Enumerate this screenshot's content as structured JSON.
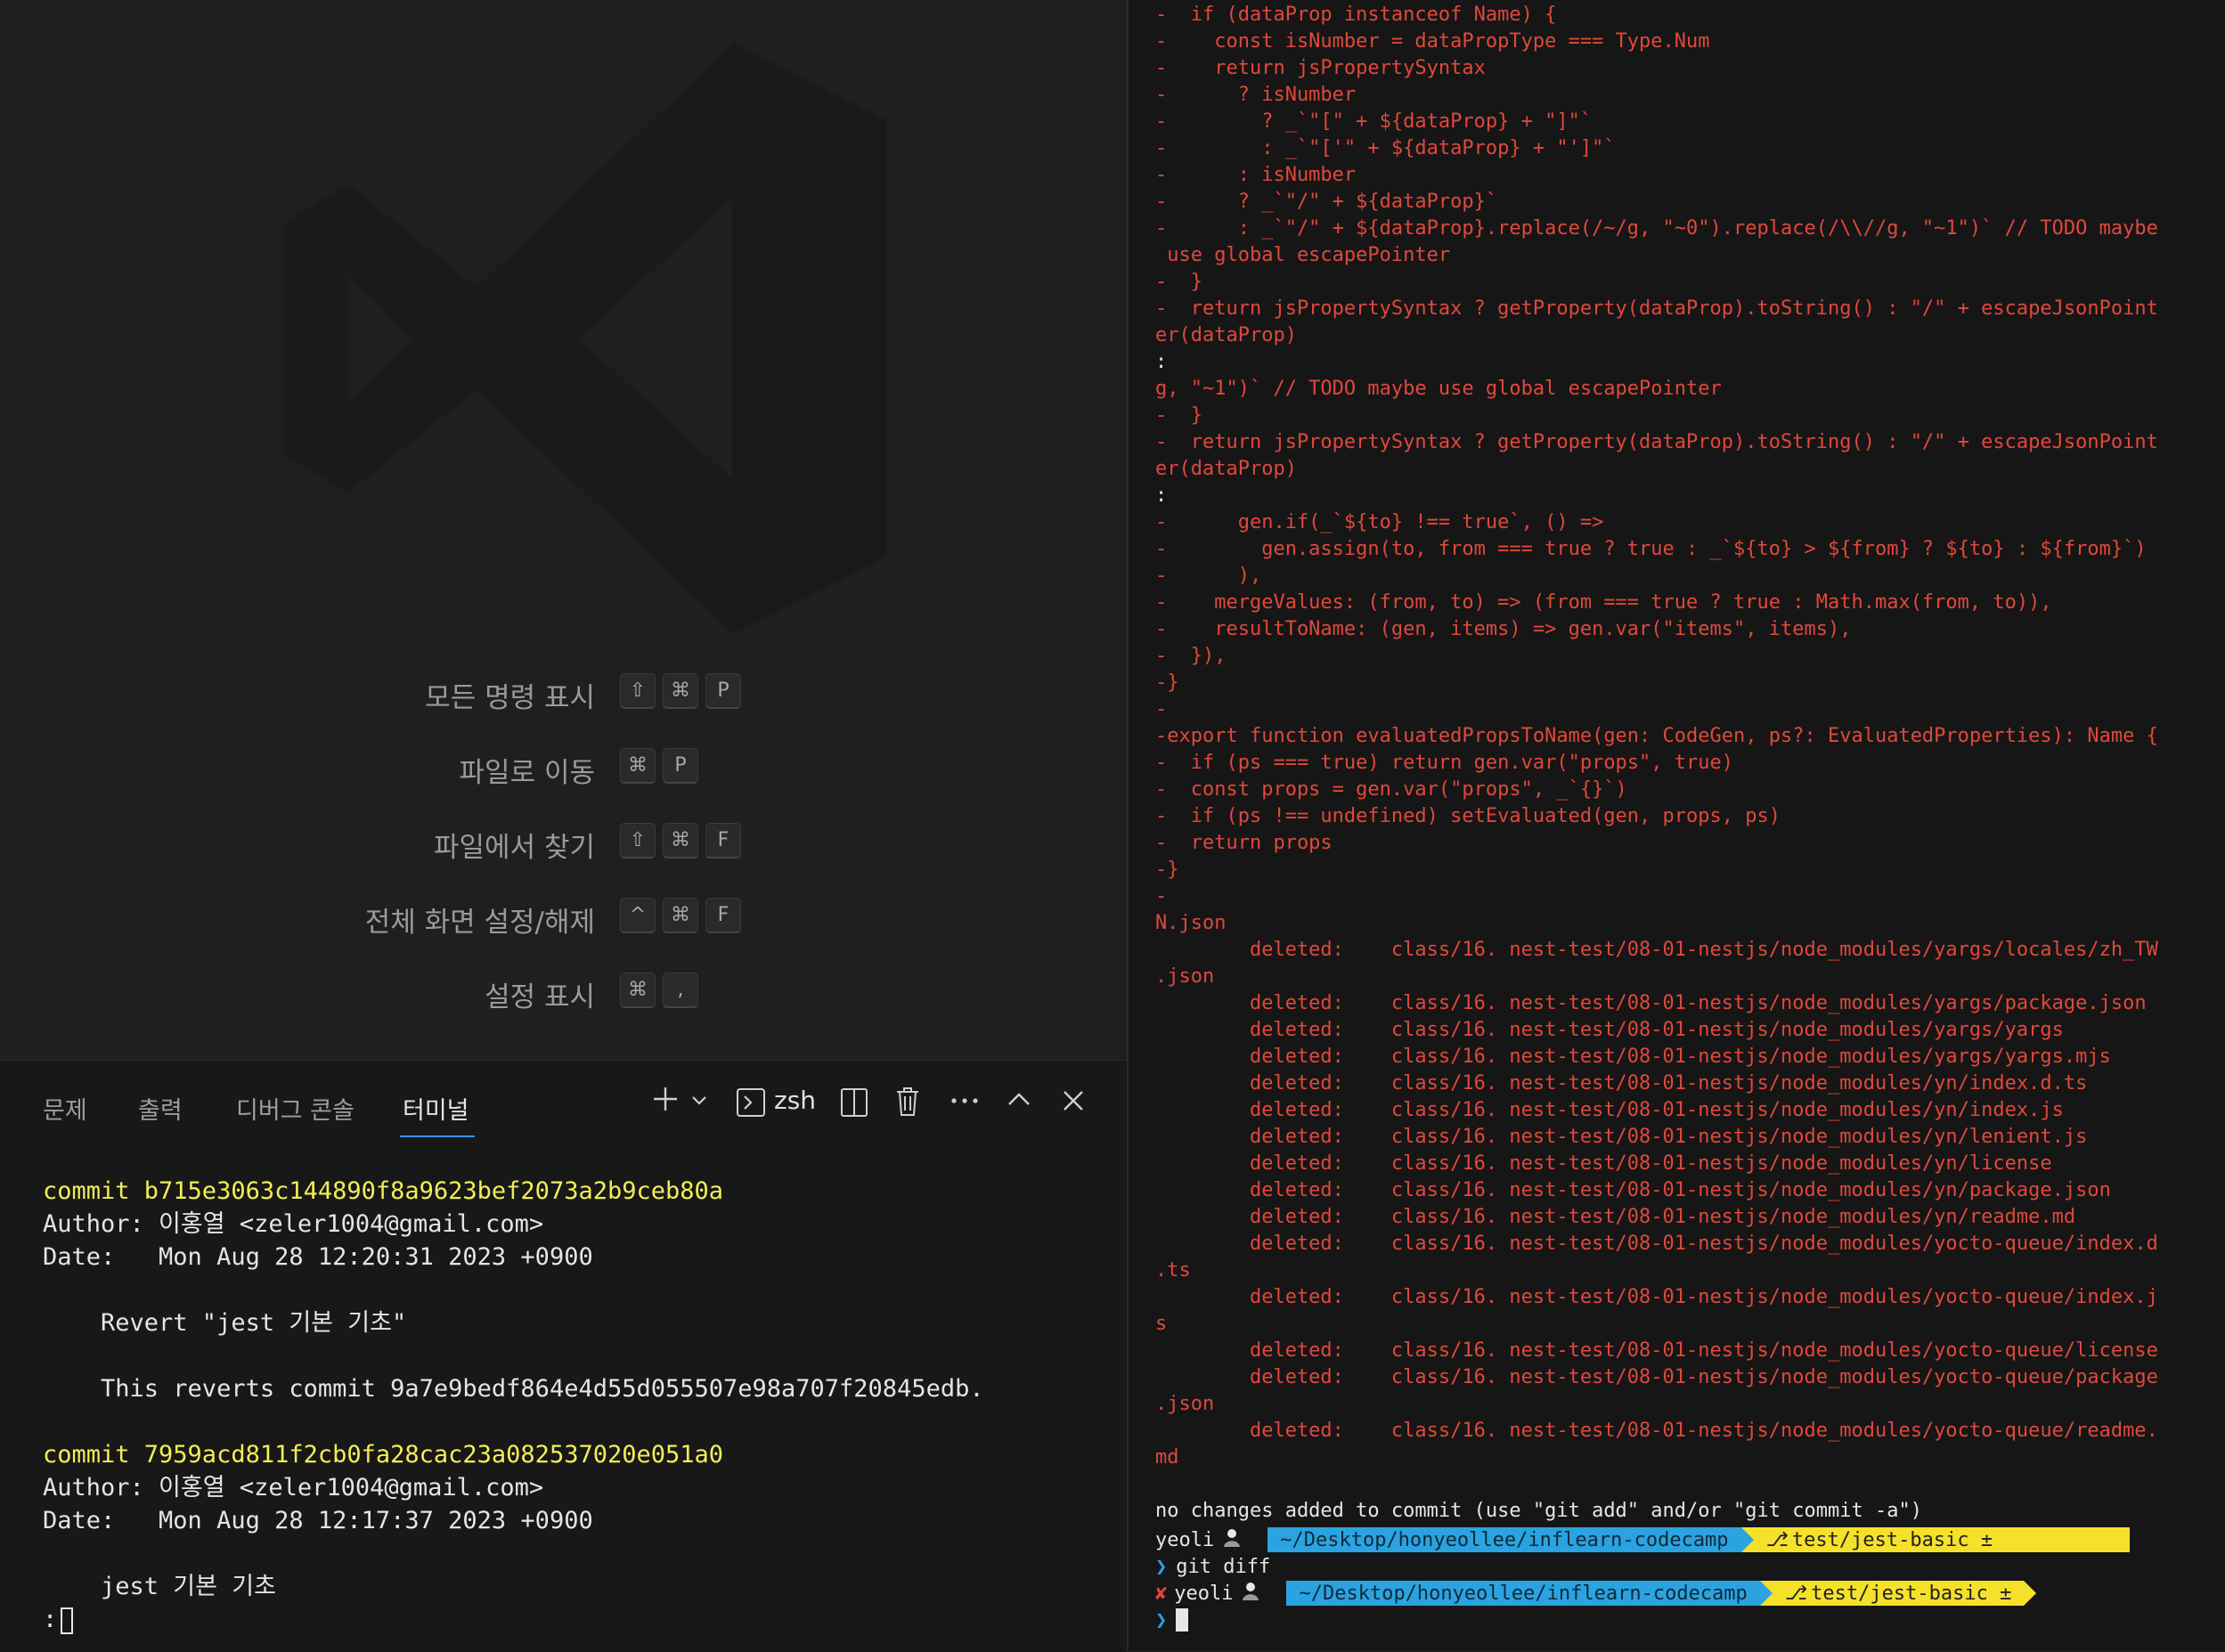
{
  "shortcuts": [
    {
      "label": "모든 명령 표시",
      "keys": [
        "⇧",
        "⌘",
        "P"
      ]
    },
    {
      "label": "파일로 이동",
      "keys": [
        "⌘",
        "P"
      ]
    },
    {
      "label": "파일에서 찾기",
      "keys": [
        "⇧",
        "⌘",
        "F"
      ]
    },
    {
      "label": "전체 화면 설정/해제",
      "keys": [
        "^",
        "⌘",
        "F"
      ]
    },
    {
      "label": "설정 표시",
      "keys": [
        "⌘",
        ","
      ]
    }
  ],
  "panel": {
    "tabs": [
      "문제",
      "출력",
      "디버그 콘솔",
      "터미널"
    ],
    "active_tab": "터미널",
    "shell_label": "zsh"
  },
  "left_terminal": {
    "lines": [
      {
        "text": "commit b715e3063c144890f8a9623bef2073a2b9ceb80a",
        "color": "yellow"
      },
      {
        "text": "Author: 이홍열 <zeler1004@gmail.com>",
        "color": "white"
      },
      {
        "text": "Date:   Mon Aug 28 12:20:31 2023 +0900",
        "color": "white"
      },
      {
        "text": "",
        "color": "white"
      },
      {
        "text": "    Revert \"jest 기본 기초\"",
        "color": "white"
      },
      {
        "text": "",
        "color": "white"
      },
      {
        "text": "    This reverts commit 9a7e9bedf864e4d55d055507e98a707f20845edb.",
        "color": "white"
      },
      {
        "text": "",
        "color": "white"
      },
      {
        "text": "commit 7959acd811f2cb0fa28cac23a082537020e051a0",
        "color": "yellow"
      },
      {
        "text": "Author: 이홍열 <zeler1004@gmail.com>",
        "color": "white"
      },
      {
        "text": "Date:   Mon Aug 28 12:17:37 2023 +0900",
        "color": "white"
      },
      {
        "text": "",
        "color": "white"
      },
      {
        "text": "    jest 기본 기초",
        "color": "white"
      },
      {
        "text": ":",
        "color": "white"
      }
    ]
  },
  "right_terminal": {
    "lines": [
      {
        "text": "-  if (dataProp instanceof Name) {",
        "color": "red"
      },
      {
        "text": "-    const isNumber = dataPropType === Type.Num",
        "color": "red"
      },
      {
        "text": "-    return jsPropertySyntax",
        "color": "red"
      },
      {
        "text": "-      ? isNumber",
        "color": "red"
      },
      {
        "text": "-        ? _`\"[\" + ${dataProp} + \"]\"`",
        "color": "red"
      },
      {
        "text": "-        : _`\"['\" + ${dataProp} + \"']\"`",
        "color": "red"
      },
      {
        "text": "-      : isNumber",
        "color": "red"
      },
      {
        "text": "-      ? _`\"/\" + ${dataProp}`",
        "color": "red"
      },
      {
        "text": "-      : _`\"/\" + ${dataProp}.replace(/~/g, \"~0\").replace(/\\\\//g, \"~1\")` // TODO maybe",
        "color": "red"
      },
      {
        "text": " use global escapePointer",
        "color": "red"
      },
      {
        "text": "-  }",
        "color": "red"
      },
      {
        "text": "-  return jsPropertySyntax ? getProperty(dataProp).toString() : \"/\" + escapeJsonPoint",
        "color": "red"
      },
      {
        "text": "er(dataProp)",
        "color": "red"
      },
      {
        "text": ":",
        "color": "white"
      },
      {
        "text": "g, \"~1\")` // TODO maybe use global escapePointer",
        "color": "red"
      },
      {
        "text": "-  }",
        "color": "red"
      },
      {
        "text": "-  return jsPropertySyntax ? getProperty(dataProp).toString() : \"/\" + escapeJsonPoint",
        "color": "red"
      },
      {
        "text": "er(dataProp)",
        "color": "red"
      },
      {
        "text": ":",
        "color": "white"
      },
      {
        "text": "-      gen.if(_`${to} !== true`, () =>",
        "color": "red"
      },
      {
        "text": "-        gen.assign(to, from === true ? true : _`${to} > ${from} ? ${to} : ${from}`)",
        "color": "red"
      },
      {
        "text": "-      ),",
        "color": "red"
      },
      {
        "text": "-    mergeValues: (from, to) => (from === true ? true : Math.max(from, to)),",
        "color": "red"
      },
      {
        "text": "-    resultToName: (gen, items) => gen.var(\"items\", items),",
        "color": "red"
      },
      {
        "text": "-  }),",
        "color": "red"
      },
      {
        "text": "-}",
        "color": "red"
      },
      {
        "text": "-",
        "color": "red"
      },
      {
        "text": "-export function evaluatedPropsToName(gen: CodeGen, ps?: EvaluatedProperties): Name {",
        "color": "red"
      },
      {
        "text": "-  if (ps === true) return gen.var(\"props\", true)",
        "color": "red"
      },
      {
        "text": "-  const props = gen.var(\"props\", _`{}`)",
        "color": "red"
      },
      {
        "text": "-  if (ps !== undefined) setEvaluated(gen, props, ps)",
        "color": "red"
      },
      {
        "text": "-  return props",
        "color": "red"
      },
      {
        "text": "-}",
        "color": "red"
      },
      {
        "text": "-",
        "color": "red"
      },
      {
        "text": "N.json",
        "color": "red"
      },
      {
        "text": "        deleted:    class/16. nest-test/08-01-nestjs/node_modules/yargs/locales/zh_TW",
        "color": "red"
      },
      {
        "text": ".json",
        "color": "red"
      },
      {
        "text": "        deleted:    class/16. nest-test/08-01-nestjs/node_modules/yargs/package.json",
        "color": "red"
      },
      {
        "text": "        deleted:    class/16. nest-test/08-01-nestjs/node_modules/yargs/yargs",
        "color": "red"
      },
      {
        "text": "        deleted:    class/16. nest-test/08-01-nestjs/node_modules/yargs/yargs.mjs",
        "color": "red"
      },
      {
        "text": "        deleted:    class/16. nest-test/08-01-nestjs/node_modules/yn/index.d.ts",
        "color": "red"
      },
      {
        "text": "        deleted:    class/16. nest-test/08-01-nestjs/node_modules/yn/index.js",
        "color": "red"
      },
      {
        "text": "        deleted:    class/16. nest-test/08-01-nestjs/node_modules/yn/lenient.js",
        "color": "red"
      },
      {
        "text": "        deleted:    class/16. nest-test/08-01-nestjs/node_modules/yn/license",
        "color": "red"
      },
      {
        "text": "        deleted:    class/16. nest-test/08-01-nestjs/node_modules/yn/package.json",
        "color": "red"
      },
      {
        "text": "        deleted:    class/16. nest-test/08-01-nestjs/node_modules/yn/readme.md",
        "color": "red"
      },
      {
        "text": "        deleted:    class/16. nest-test/08-01-nestjs/node_modules/yocto-queue/index.d",
        "color": "red"
      },
      {
        "text": ".ts",
        "color": "red"
      },
      {
        "text": "        deleted:    class/16. nest-test/08-01-nestjs/node_modules/yocto-queue/index.j",
        "color": "red"
      },
      {
        "text": "s",
        "color": "red"
      },
      {
        "text": "        deleted:    class/16. nest-test/08-01-nestjs/node_modules/yocto-queue/license",
        "color": "red"
      },
      {
        "text": "        deleted:    class/16. nest-test/08-01-nestjs/node_modules/yocto-queue/package",
        "color": "red"
      },
      {
        "text": ".json",
        "color": "red"
      },
      {
        "text": "        deleted:    class/16. nest-test/08-01-nestjs/node_modules/yocto-queue/readme.",
        "color": "red"
      },
      {
        "text": "md",
        "color": "red"
      },
      {
        "text": "",
        "color": "white"
      },
      {
        "text": "no changes added to commit (use \"git add\" and/or \"git commit -a\")",
        "color": "white"
      }
    ],
    "prompt1": {
      "user": "yeoli",
      "path": "~/Desktop/honyeollee/inflearn-codecamp",
      "branch": "test/jest-basic ±"
    },
    "command": "git diff",
    "prompt2": {
      "status": "✘",
      "user": "yeoli",
      "path": "~/Desktop/honyeollee/inflearn-codecamp",
      "branch": "test/jest-basic ±"
    }
  },
  "colors": {
    "editor_bg": "#1f1f1f",
    "panel_bg": "#181818",
    "terminal_right_bg": "#161616",
    "diff_red": "#e0483b",
    "commit_yellow": "#f2ee56",
    "tab_underline": "#3794ff",
    "prompt_path_bg": "#2aa3e0",
    "prompt_branch_bg": "#f5e12a"
  },
  "icons": {
    "watermark": "vscode-logo-icon",
    "new_terminal": "plus-icon",
    "dropdown": "chevron-down-icon",
    "shell": "terminal-icon",
    "split": "split-icon",
    "trash": "trash-icon",
    "more": "ellipsis-icon",
    "maximize": "chevron-up-icon",
    "close": "close-icon"
  }
}
